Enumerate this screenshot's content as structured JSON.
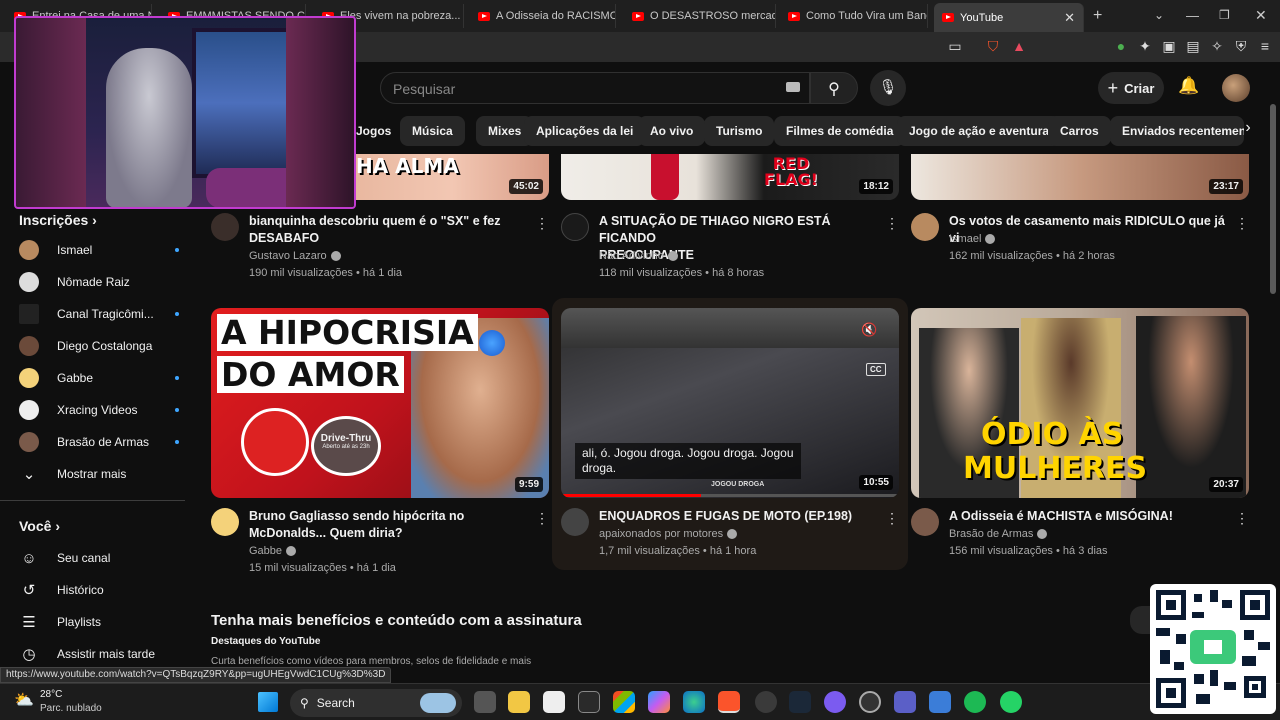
{
  "browser": {
    "tabs": [
      {
        "label": "Entrei na Casa de uma Nov"
      },
      {
        "label": "EMMMISTAS SENDO CONS"
      },
      {
        "label": "Eles vivem na pobreza... m"
      },
      {
        "label": "A Odisseia do RACISMO! -"
      },
      {
        "label": "O DESASTROSO mercado c"
      },
      {
        "label": "Como Tudo Vira um Banco"
      },
      {
        "label": "YouTube",
        "active": true
      }
    ],
    "new_tab": "+",
    "status_url": "https://www.youtube.com/watch?v=QTsBqzqZ9RY&pp=ugUHEgVwdC1CUg%3D%3D"
  },
  "youtube": {
    "search_placeholder": "Pesquisar",
    "create_label": "Criar",
    "chips": [
      "Jogos",
      "Música",
      "Mixes",
      "Aplicações da lei",
      "Ao vivo",
      "Turismo",
      "Filmes de comédia",
      "Jogo de ação e aventura",
      "Carros",
      "Enviados recentemente"
    ]
  },
  "sidebar": {
    "subscriptions_header": "Inscrições",
    "subscriptions": [
      {
        "label": "Ismael"
      },
      {
        "label": "Nômade Raiz"
      },
      {
        "label": "Canal Tragicômi..."
      },
      {
        "label": "Diego Costalonga"
      },
      {
        "label": "Gabbe"
      },
      {
        "label": "Xracing Videos"
      },
      {
        "label": "Brasão de Armas"
      }
    ],
    "show_more": "Mostrar mais",
    "you_header": "Você",
    "you_items": [
      {
        "label": "Seu canal",
        "icon": "person-icon"
      },
      {
        "label": "Histórico",
        "icon": "history-icon"
      },
      {
        "label": "Playlists",
        "icon": "playlist-icon"
      },
      {
        "label": "Assistir mais tarde",
        "icon": "clock-icon"
      }
    ]
  },
  "videos_row1": [
    {
      "title_line1": "bianquinha descobriu quem é o \"SX\" e fez",
      "title_line2": "DESABAFO",
      "channel": "Gustavo Lazaro",
      "meta": "190 mil visualizações • há 1 dia",
      "duration": "45:02",
      "thumb_text": "HA ALMA"
    },
    {
      "title_line1": "A SITUAÇÃO DE THIAGO NIGRO ESTÁ FICANDO",
      "title_line2": "PREOCUPANTE",
      "channel": "Não Adivinho",
      "meta": "118 mil visualizações • há 8 horas",
      "duration": "18:12",
      "thumb_text": "RED FLAG!"
    },
    {
      "title_line1": "Os votos de casamento mais RIDICULO que já vi",
      "title_line2": "",
      "channel": "Ismael",
      "meta": "162 mil visualizações • há 2 horas",
      "duration": "23:17"
    }
  ],
  "videos_row2": [
    {
      "title_line1": "Bruno Gagliasso sendo hipócrita no",
      "title_line2": "McDonalds... Quem diria?",
      "channel": "Gabbe",
      "meta": "15 mil visualizações • há 1 dia",
      "duration": "9:59",
      "thumb_text_1": "A HIPOCRISIA",
      "thumb_text_2": "DO AMOR",
      "drive_thru": "Drive-Thru",
      "drive_sub": "Aberto até as 23h"
    },
    {
      "title_line1": "ENQUADROS E FUGAS DE MOTO (EP.198)",
      "title_line2": "",
      "channel": "apaixonados por motores",
      "meta": "1,7 mil visualizações • há 1 hora",
      "duration": "10:55",
      "caption_line1": "ali, ó. Jogou droga. Jogou droga. Jogou",
      "caption_line2": "droga.",
      "cc": "CC",
      "bottom_label": "JOGOU DROGA"
    },
    {
      "title_line1": "A Odisseia é MACHISTA e MISÓGINA!",
      "title_line2": "",
      "channel": "Brasão de Armas",
      "meta": "156 mil visualizações • há 3 dias",
      "duration": "20:37",
      "thumb_text_1": "ÓDIO ÀS",
      "thumb_text_2": "MULHERES"
    }
  ],
  "promo": {
    "title": "Tenha mais benefícios e conteúdo com a assinatura",
    "subtitle": "Destaques do YouTube",
    "description": "Curta benefícios como vídeos para membros, selos de fidelidade e mais"
  },
  "taskbar": {
    "temperature": "28°C",
    "weather": "Parc. nublado",
    "search": "Search"
  }
}
